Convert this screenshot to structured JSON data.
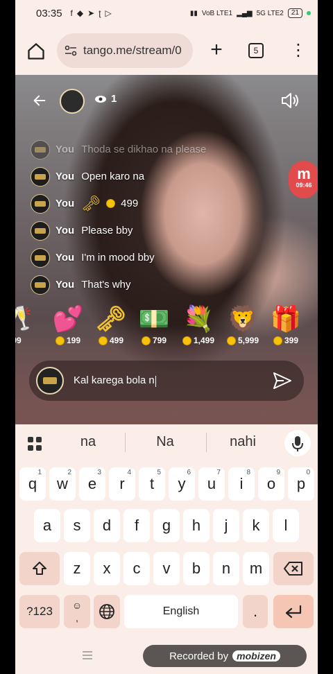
{
  "status_bar": {
    "time": "03:35",
    "app_icons": [
      "f",
      "snapchat",
      "telegram",
      "tango",
      "play"
    ],
    "network_left": "VoB LTE1",
    "network_right": "5G LTE2",
    "battery": "21"
  },
  "browser": {
    "url": "tango.me/stream/0",
    "tab_count": "5"
  },
  "stream": {
    "viewer_count": "1",
    "rec_time": "09:46",
    "chat": [
      {
        "user": "You",
        "text": "Thoda se dikhao na please",
        "faded": true
      },
      {
        "user": "You",
        "text": "Open karo na",
        "faded": false
      },
      {
        "user": "You",
        "text": "499",
        "gift": "key",
        "faded": false
      },
      {
        "user": "You",
        "text": "Please bby",
        "faded": false
      },
      {
        "user": "You",
        "text": "I'm in mood bby",
        "faded": false
      },
      {
        "user": "You",
        "text": "That's why",
        "faded": false
      }
    ],
    "gifts": [
      {
        "name": "champagne-gift",
        "price": "99"
      },
      {
        "name": "hearts-gift",
        "price": "199"
      },
      {
        "name": "key-gift",
        "price": "499"
      },
      {
        "name": "cash-gift",
        "price": "799"
      },
      {
        "name": "rose-basket-gift",
        "price": "1,499"
      },
      {
        "name": "lion-gift",
        "price": "5,999"
      },
      {
        "name": "present-gift",
        "price": "399"
      }
    ],
    "composer_text": "Kal karega bola n"
  },
  "keyboard": {
    "suggestions": [
      "na",
      "Na",
      "nahi"
    ],
    "row1": [
      "q",
      "w",
      "e",
      "r",
      "t",
      "y",
      "u",
      "i",
      "o",
      "p"
    ],
    "row1_nums": [
      "1",
      "2",
      "3",
      "4",
      "5",
      "6",
      "7",
      "8",
      "9",
      "0"
    ],
    "row2": [
      "a",
      "s",
      "d",
      "f",
      "g",
      "h",
      "j",
      "k",
      "l"
    ],
    "row3": [
      "z",
      "x",
      "c",
      "v",
      "b",
      "n",
      "m"
    ],
    "sym_label": "?123",
    "emoji_comma": ",",
    "space_label": "English",
    "period": "."
  },
  "footer": {
    "recorded_label": "Recorded by",
    "recorded_brand": "mobizen"
  }
}
